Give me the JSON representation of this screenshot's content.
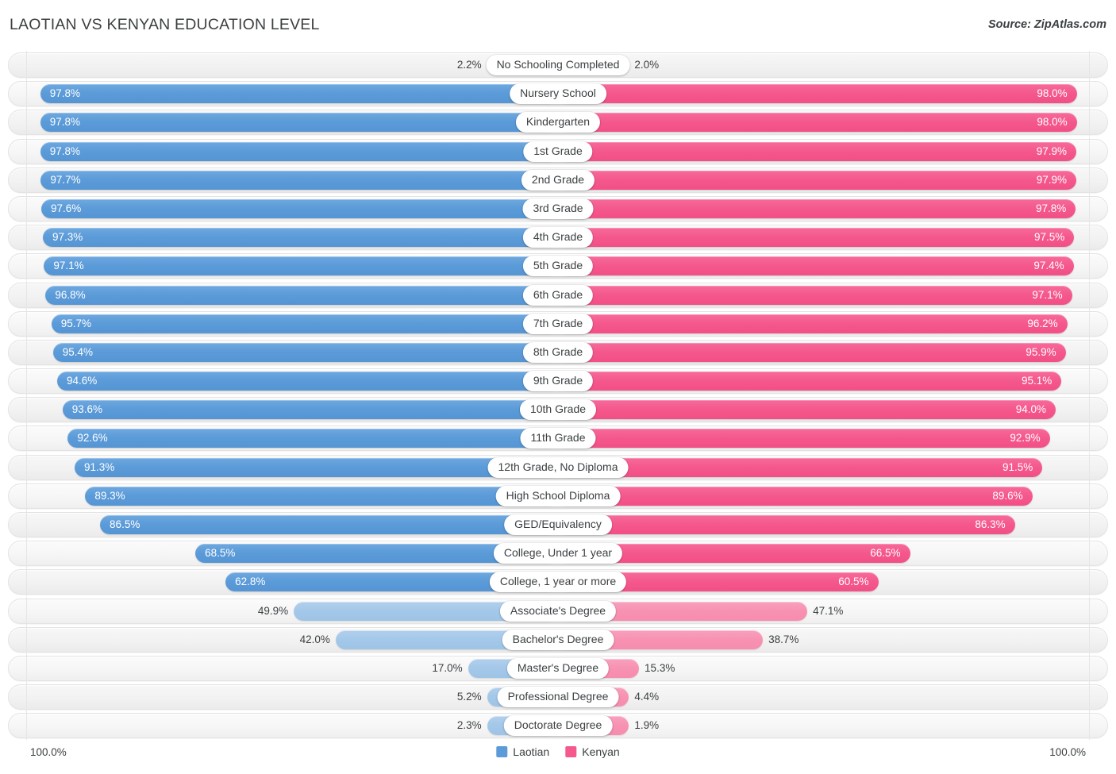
{
  "header": {
    "title": "LAOTIAN VS KENYAN EDUCATION LEVEL",
    "source": "Source: ZipAtlas.com"
  },
  "legend": {
    "items": [
      {
        "label": "Laotian",
        "color": "#5b9bd8"
      },
      {
        "label": "Kenyan",
        "color": "#f4588c"
      }
    ]
  },
  "axis": {
    "min_label": "100.0%",
    "max_label": "100.0%"
  },
  "colors": {
    "left_strong": "#5b9bd8",
    "left_light": "#a4c8e9",
    "right_strong": "#f4588c",
    "right_light": "#f792b2",
    "track": "#f2f2f2",
    "text": "#3c4043"
  },
  "chart_data": {
    "type": "bar",
    "title": "LAOTIAN VS KENYAN EDUCATION LEVEL",
    "subtitle": "Source: ZipAtlas.com",
    "orientation": "horizontal-diverging",
    "xlabel": "",
    "ylabel": "",
    "xlim": [
      0,
      100
    ],
    "axis_min_label": "100.0%",
    "axis_max_label": "100.0%",
    "grid": false,
    "legend_position": "bottom-center",
    "categories": [
      "No Schooling Completed",
      "Nursery School",
      "Kindergarten",
      "1st Grade",
      "2nd Grade",
      "3rd Grade",
      "4th Grade",
      "5th Grade",
      "6th Grade",
      "7th Grade",
      "8th Grade",
      "9th Grade",
      "10th Grade",
      "11th Grade",
      "12th Grade, No Diploma",
      "High School Diploma",
      "GED/Equivalency",
      "College, Under 1 year",
      "College, 1 year or more",
      "Associate's Degree",
      "Bachelor's Degree",
      "Master's Degree",
      "Professional Degree",
      "Doctorate Degree"
    ],
    "series": [
      {
        "name": "Laotian",
        "side": "left",
        "color": "#5b9bd8",
        "values": [
          2.2,
          97.8,
          97.8,
          97.8,
          97.7,
          97.6,
          97.3,
          97.1,
          96.8,
          95.7,
          95.4,
          94.6,
          93.6,
          92.6,
          91.3,
          89.3,
          86.5,
          68.5,
          62.8,
          49.9,
          42.0,
          17.0,
          5.2,
          2.3
        ],
        "labels": [
          "2.2%",
          "97.8%",
          "97.8%",
          "97.8%",
          "97.7%",
          "97.6%",
          "97.3%",
          "97.1%",
          "96.8%",
          "95.7%",
          "95.4%",
          "94.6%",
          "93.6%",
          "92.6%",
          "91.3%",
          "89.3%",
          "86.5%",
          "68.5%",
          "62.8%",
          "49.9%",
          "42.0%",
          "17.0%",
          "5.2%",
          "2.3%"
        ]
      },
      {
        "name": "Kenyan",
        "side": "right",
        "color": "#f4588c",
        "values": [
          2.0,
          98.0,
          98.0,
          97.9,
          97.9,
          97.8,
          97.5,
          97.4,
          97.1,
          96.2,
          95.9,
          95.1,
          94.0,
          92.9,
          91.5,
          89.6,
          86.3,
          66.5,
          60.5,
          47.1,
          38.7,
          15.3,
          4.4,
          1.9
        ],
        "labels": [
          "2.0%",
          "98.0%",
          "98.0%",
          "97.9%",
          "97.9%",
          "97.8%",
          "97.5%",
          "97.4%",
          "97.1%",
          "96.2%",
          "95.9%",
          "95.1%",
          "94.0%",
          "92.9%",
          "91.5%",
          "89.6%",
          "86.3%",
          "66.5%",
          "60.5%",
          "47.1%",
          "38.7%",
          "15.3%",
          "4.4%",
          "1.9%"
        ]
      }
    ]
  }
}
